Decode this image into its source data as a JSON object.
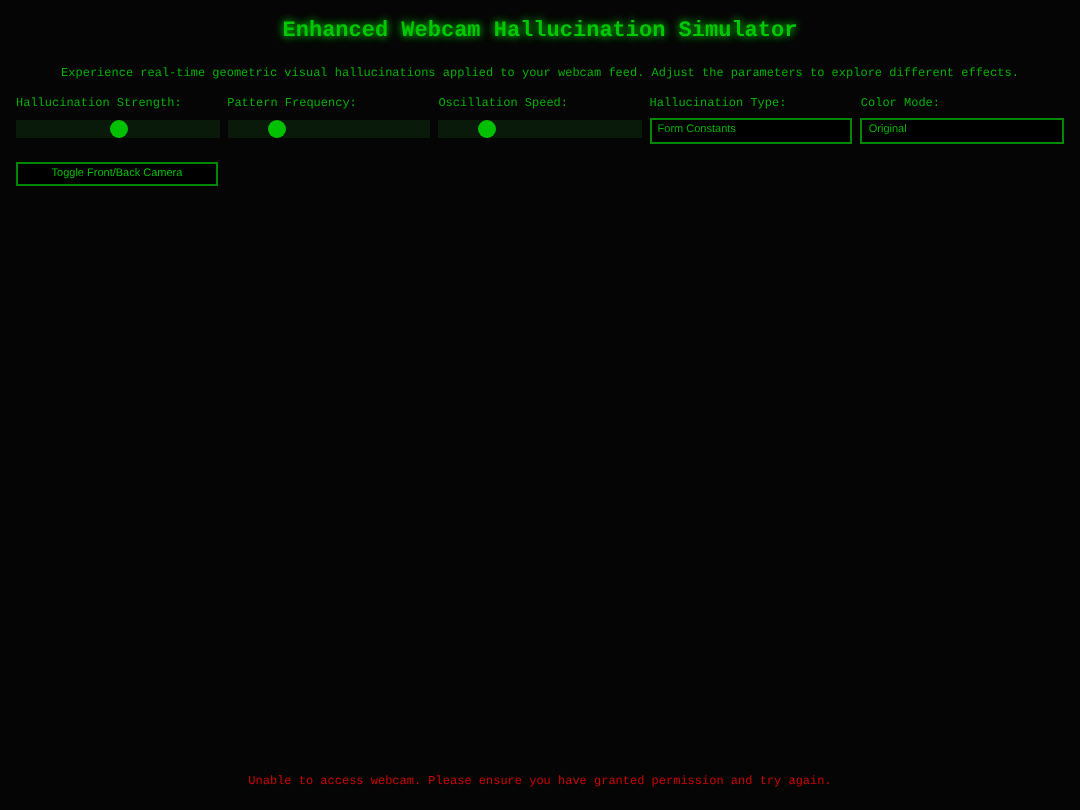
{
  "title": "Enhanced Webcam Hallucination Simulator",
  "description": "Experience real-time geometric visual hallucinations applied to your webcam feed. Adjust the parameters to explore different effects.",
  "controls": [
    {
      "kind": "slider",
      "label": "Hallucination Strength:",
      "level": 0.5
    },
    {
      "kind": "slider",
      "label": "Pattern Frequency:",
      "level": 0.24
    },
    {
      "kind": "slider",
      "label": "Oscillation Speed:",
      "level": 0.23
    },
    {
      "kind": "select",
      "label": "Hallucination Type:",
      "value": "Form Constants"
    },
    {
      "kind": "select",
      "label": "Color Mode:",
      "value": "Original"
    }
  ],
  "camera_button": "Toggle Front/Back Camera",
  "error": "Unable to access webcam. Please ensure you have granted permission and try again."
}
